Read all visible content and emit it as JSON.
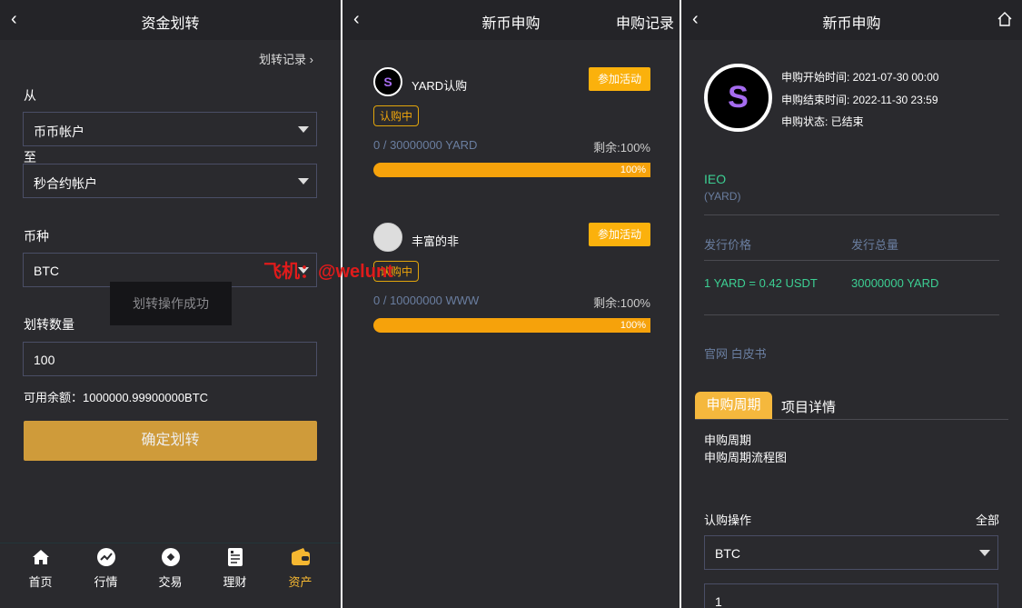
{
  "p1": {
    "title": "资金划转",
    "record": "划转记录",
    "from_label": "从",
    "from_value": "币币帐户",
    "to_label": "至",
    "to_value": "秒合约帐户",
    "coin_label": "币种",
    "coin_value": "BTC",
    "toast": "划转操作成功",
    "amount_label": "划转数量",
    "amount_value": "100",
    "balance": "可用余额：1000000.99900000BTC",
    "confirm": "确定划转",
    "watermark": "飞机：@welunt",
    "nav": [
      {
        "label": "首页",
        "icon": "home-icon"
      },
      {
        "label": "行情",
        "icon": "chart-icon"
      },
      {
        "label": "交易",
        "icon": "trade-icon"
      },
      {
        "label": "理财",
        "icon": "document-icon"
      },
      {
        "label": "资产",
        "icon": "wallet-icon",
        "active": true
      }
    ]
  },
  "p2": {
    "title": "新币申购",
    "record": "申购记录",
    "items": [
      {
        "name": "YARD认购",
        "join": "参加活动",
        "status": "认购中",
        "amount": "0 / 30000000 YARD",
        "remain": "剩余:100%",
        "progress_label": "100%",
        "progress": 100
      },
      {
        "name": "丰富的非",
        "join": "参加活动",
        "status": "认购中",
        "amount": "0 / 10000000 WWW",
        "remain": "剩余:100%",
        "progress_label": "100%",
        "progress": 100
      }
    ]
  },
  "p3": {
    "title": "新币申购",
    "start": "申购开始时间: 2021-07-30 00:00",
    "end": "申购结束时间: 2022-11-30 23:59",
    "state": "申购状态: 已结束",
    "type": "IEO",
    "symbol": "(YARD)",
    "price_label": "发行价格",
    "total_label": "发行总量",
    "price": "1 YARD = 0.42 USDT",
    "total": "30000000 YARD",
    "links": "官网 白皮书",
    "tab1": "申购周期",
    "tab2": "项目详情",
    "content1": "申购周期",
    "content2": "申购周期流程图",
    "op_label": "认购操作",
    "all": "全部",
    "coin": "BTC",
    "qty": "1"
  },
  "colors": {
    "accent": "#fbb10c",
    "green": "#3ccf93",
    "bg": "#2a2a2e"
  }
}
